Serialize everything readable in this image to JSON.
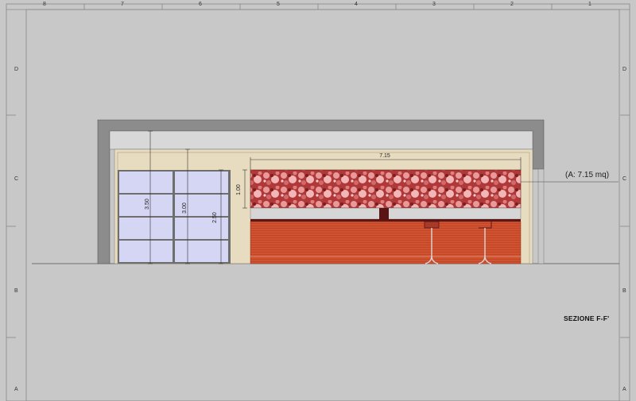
{
  "sheet": {
    "top_columns": [
      "8",
      "7",
      "6",
      "5",
      "4",
      "3",
      "2",
      "1"
    ],
    "left_rows": [
      "D",
      "C",
      "B",
      "A"
    ],
    "right_rows": [
      "D",
      "C",
      "B",
      "A"
    ]
  },
  "drawing": {
    "dimensions": {
      "width_label": "7.15",
      "height_label_panel": "1.00",
      "height_label_total": "3.50",
      "height_label_mid": "3.00",
      "height_label_door": "2.50"
    },
    "area_callout": "(A: 7.15 mq)",
    "section_title": "SEZIONE F-F'",
    "colors": {
      "wall": "#8c8c8c",
      "interior": "#e8dcc0",
      "glass": "#d4d6f4",
      "panel_top": "#c84a48",
      "counter": "#d0522f",
      "dark_accent": "#5a1414"
    }
  }
}
